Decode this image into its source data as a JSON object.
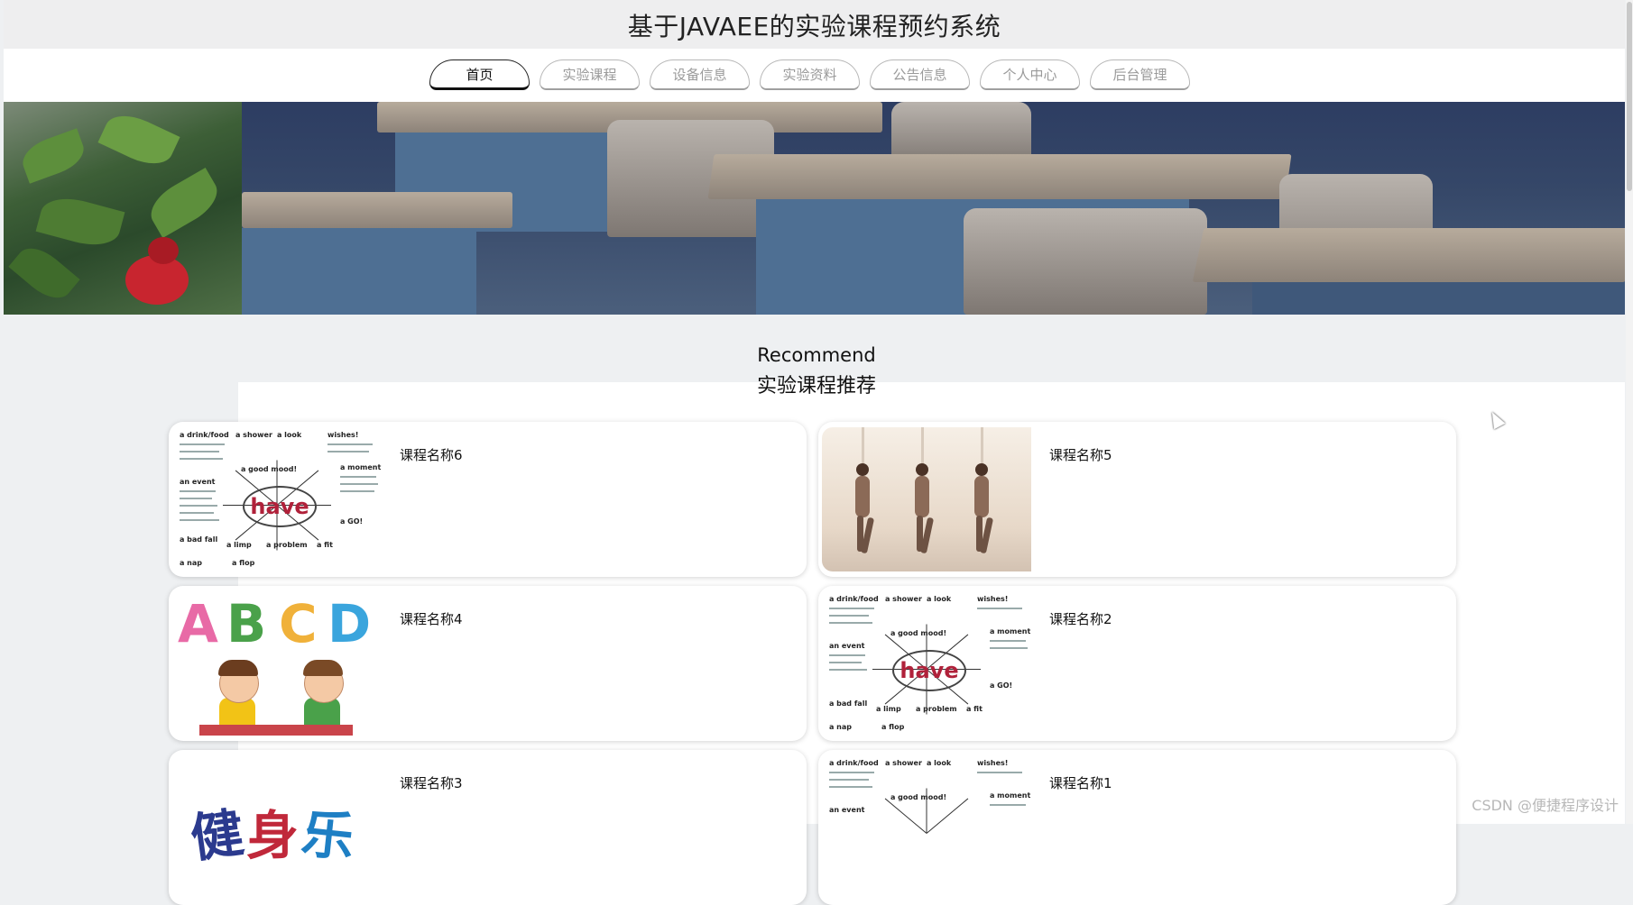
{
  "header": {
    "title": "基于JAVAEE的实验课程预约系统"
  },
  "nav": {
    "tabs": [
      {
        "label": "首页",
        "active": true
      },
      {
        "label": "实验课程",
        "active": false
      },
      {
        "label": "设备信息",
        "active": false
      },
      {
        "label": "实验资料",
        "active": false
      },
      {
        "label": "公告信息",
        "active": false
      },
      {
        "label": "个人中心",
        "active": false
      },
      {
        "label": "后台管理",
        "active": false
      }
    ]
  },
  "recommend": {
    "title_en": "Recommend",
    "title_cn": "实验课程推荐",
    "courses": [
      {
        "name": "课程名称6",
        "image": "have-mindmap"
      },
      {
        "name": "课程名称5",
        "image": "yoga-class"
      },
      {
        "name": "课程名称4",
        "image": "abcd-kids"
      },
      {
        "name": "课程名称2",
        "image": "have-mindmap"
      },
      {
        "name": "课程名称3",
        "image": "calligraphy"
      },
      {
        "name": "课程名称1",
        "image": "have-mindmap"
      }
    ]
  },
  "watermark": "CSDN @便捷程序设计",
  "colors": {
    "accent": "#111111",
    "tab_inactive": "#9a9a9a",
    "page_bg": "#eef0f2"
  }
}
